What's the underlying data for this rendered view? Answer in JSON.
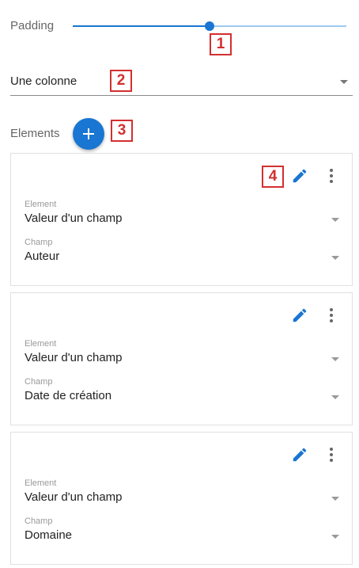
{
  "padding": {
    "label": "Padding",
    "value_fraction": 0.5
  },
  "layout_select": {
    "value": "Une colonne"
  },
  "elements": {
    "label": "Elements"
  },
  "markers": [
    "1",
    "2",
    "3",
    "4"
  ],
  "colors": {
    "accent": "#1976d2",
    "marker": "#d32f2f"
  },
  "cards": [
    {
      "element_label": "Element",
      "element_value": "Valeur d'un champ",
      "champ_label": "Champ",
      "champ_value": "Auteur"
    },
    {
      "element_label": "Element",
      "element_value": "Valeur d'un champ",
      "champ_label": "Champ",
      "champ_value": "Date de création"
    },
    {
      "element_label": "Element",
      "element_value": "Valeur d'un champ",
      "champ_label": "Champ",
      "champ_value": "Domaine"
    }
  ]
}
